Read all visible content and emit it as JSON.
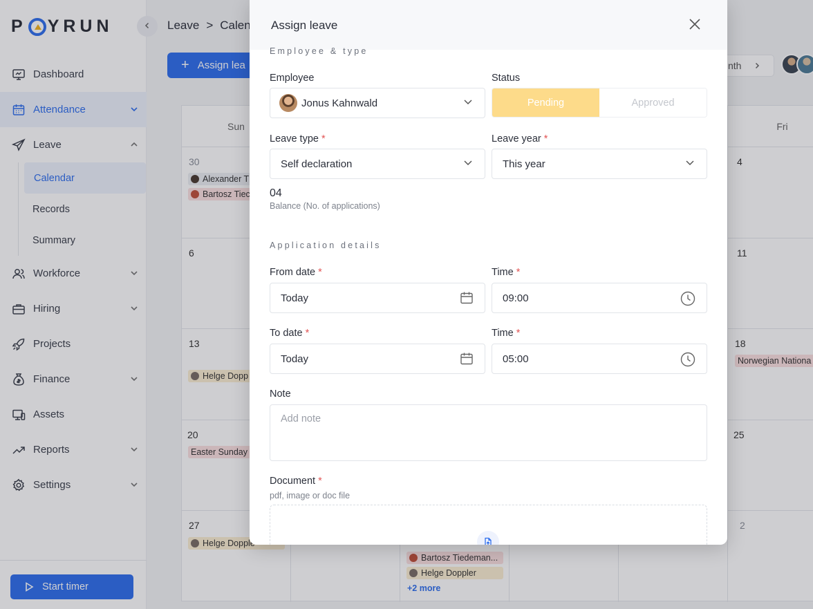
{
  "brand": {
    "logo_left": "P",
    "logo_right": "YRUN"
  },
  "sidebar": {
    "items": [
      {
        "label": "Dashboard"
      },
      {
        "label": "Attendance"
      },
      {
        "label": "Leave"
      },
      {
        "label": "Workforce"
      },
      {
        "label": "Hiring"
      },
      {
        "label": "Projects"
      },
      {
        "label": "Finance"
      },
      {
        "label": "Assets"
      },
      {
        "label": "Reports"
      },
      {
        "label": "Settings"
      }
    ],
    "leave_sub": [
      {
        "label": "Calendar"
      },
      {
        "label": "Records"
      },
      {
        "label": "Summary"
      }
    ],
    "timer_label": "Start timer"
  },
  "header": {
    "crumb_1": "Leave",
    "crumb_sep": ">",
    "crumb_2": "Calen",
    "assign_label": "Assign lea",
    "month_label": "nth"
  },
  "calendar": {
    "days": {
      "sun": "Sun",
      "fri": "Fri"
    },
    "numbers": {
      "c30": "30",
      "c4": "4",
      "c6": "6",
      "c11": "11",
      "c13": "13",
      "c18": "18",
      "c20": "20",
      "c25": "25",
      "c27": "27",
      "c2": "2"
    },
    "chips": {
      "alexander": "Alexander T",
      "bartosz1": "Bartosz Tiec",
      "helge1": "Helge Dopp",
      "norwegian": "Norwegian Nationa",
      "easter": "Easter Sunday",
      "helge2": "Helge Dopple",
      "bartosz2": "Bartosz Tiedeman...",
      "helge3": "Helge Doppler"
    },
    "more": "+2 more"
  },
  "modal": {
    "title": "Assign leave",
    "section_1": "Employee & type",
    "employee_label": "Employee",
    "employee_value": "Jonus Kahnwald",
    "status_label": "Status",
    "status_pending": "Pending",
    "status_approved": "Approved",
    "leave_type_label": "Leave type",
    "leave_type_value": "Self declaration",
    "leave_year_label": "Leave year",
    "leave_year_value": "This year",
    "balance_value": "04",
    "balance_caption": "Balance (No. of applications)",
    "section_2": "Application details",
    "from_date_label": "From date",
    "from_date_value": "Today",
    "from_time_label": "Time",
    "from_time_value": "09:00",
    "to_date_label": "To date",
    "to_date_value": "Today",
    "to_time_label": "Time",
    "to_time_value": "05:00",
    "note_label": "Note",
    "note_placeholder": "Add note",
    "document_label": "Document",
    "document_hint": "pdf, image or doc file",
    "required_mark": "*"
  },
  "colors": {
    "primary": "#2f6fed",
    "pending": "#fddb8a",
    "required": "#e25555"
  }
}
